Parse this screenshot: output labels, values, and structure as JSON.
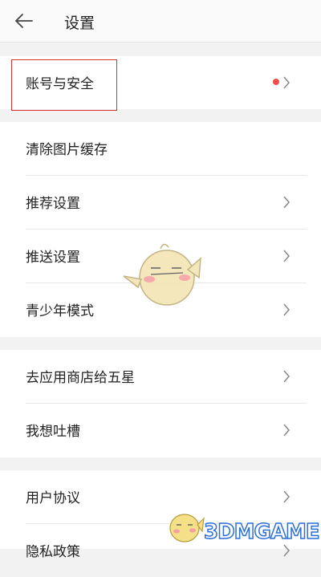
{
  "header": {
    "title": "设置",
    "back_icon": "arrow-left-icon"
  },
  "sections": [
    {
      "items": [
        {
          "label": "账号与安全",
          "has_dot": true,
          "has_chevron": true
        }
      ]
    },
    {
      "items": [
        {
          "label": "清除图片缓存",
          "has_chevron": false
        },
        {
          "label": "推荐设置",
          "has_chevron": true
        },
        {
          "label": "推送设置",
          "has_chevron": true
        },
        {
          "label": "青少年模式",
          "has_chevron": true
        }
      ]
    },
    {
      "items": [
        {
          "label": "去应用商店给五星",
          "has_chevron": true
        },
        {
          "label": "我想吐槽",
          "has_chevron": true
        }
      ]
    },
    {
      "items": [
        {
          "label": "用户协议",
          "has_chevron": true
        },
        {
          "label": "隐私政策",
          "has_chevron": true
        }
      ]
    }
  ],
  "colors": {
    "highlight_border": "#d6312f",
    "dot": "#f04c4c"
  },
  "watermark": {
    "text": "3DMGAME"
  }
}
